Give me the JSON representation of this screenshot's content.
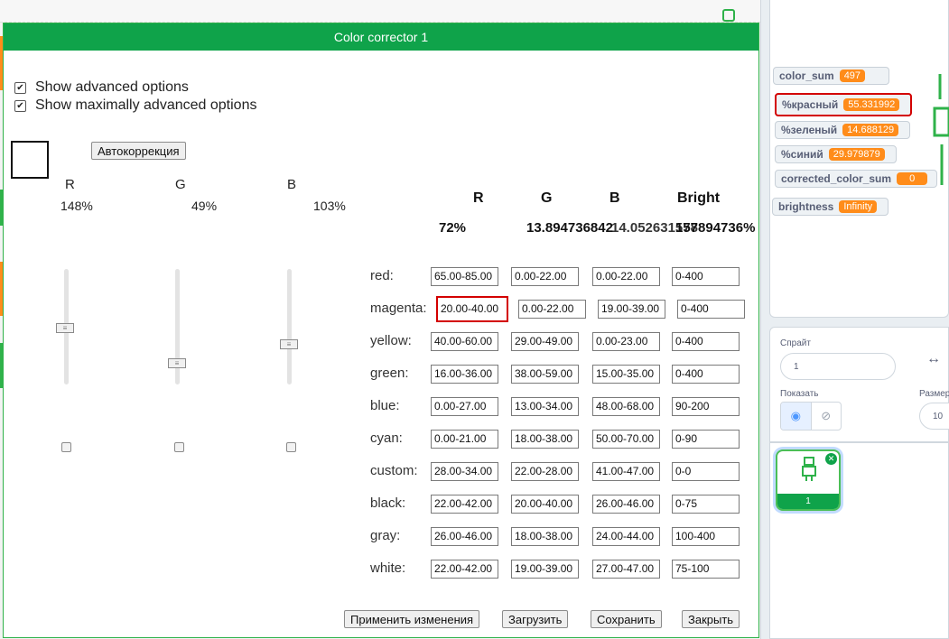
{
  "dialog": {
    "title": "Color corrector 1",
    "options": [
      {
        "label": "Show advanced options",
        "checked": true
      },
      {
        "label": "Show maximally advanced options",
        "checked": true
      }
    ],
    "autocorrect_label": "Автокоррекция",
    "channels": [
      {
        "name": "R",
        "percent": "148%"
      },
      {
        "name": "G",
        "percent": "49%"
      },
      {
        "name": "B",
        "percent": "103%"
      }
    ],
    "table_headers": [
      "R",
      "G",
      "B",
      "Bright"
    ],
    "summary": {
      "r": "72%",
      "gb_overlap": "13.894736842105263157894736%",
      "g_text": "13.894736842",
      "b_text": "14.052631578",
      "bright_text": "157894736%"
    },
    "rows": [
      {
        "name": "red:",
        "r": "65.00-85.00",
        "g": "0.00-22.00",
        "b": "0.00-22.00",
        "bright": "0-400"
      },
      {
        "name": "magenta:",
        "r": "20.00-40.00",
        "g": "0.00-22.00",
        "b": "19.00-39.00",
        "bright": "0-400"
      },
      {
        "name": "yellow:",
        "r": "40.00-60.00",
        "g": "29.00-49.00",
        "b": "0.00-23.00",
        "bright": "0-400"
      },
      {
        "name": "green:",
        "r": "16.00-36.00",
        "g": "38.00-59.00",
        "b": "15.00-35.00",
        "bright": "0-400"
      },
      {
        "name": "blue:",
        "r": "0.00-27.00",
        "g": "13.00-34.00",
        "b": "48.00-68.00",
        "bright": "90-200"
      },
      {
        "name": "cyan:",
        "r": "0.00-21.00",
        "g": "18.00-38.00",
        "b": "50.00-70.00",
        "bright": "0-90"
      },
      {
        "name": "custom:",
        "r": "28.00-34.00",
        "g": "22.00-28.00",
        "b": "41.00-47.00",
        "bright": "0-0"
      },
      {
        "name": "black:",
        "r": "22.00-42.00",
        "g": "20.00-40.00",
        "b": "26.00-46.00",
        "bright": "0-75"
      },
      {
        "name": "gray:",
        "r": "26.00-46.00",
        "g": "18.00-38.00",
        "b": "24.00-44.00",
        "bright": "100-400"
      },
      {
        "name": "white:",
        "r": "22.00-42.00",
        "g": "19.00-39.00",
        "b": "27.00-47.00",
        "bright": "75-100"
      }
    ],
    "buttons": {
      "apply": "Применить изменения",
      "load": "Загрузить",
      "save": "Сохранить",
      "close": "Закрыть"
    }
  },
  "monitors": [
    {
      "label": "color_sum",
      "value": "497"
    },
    {
      "label": "%красный",
      "value": "55.331992"
    },
    {
      "label": "%зеленый",
      "value": "14.688129"
    },
    {
      "label": "%синий",
      "value": "29.979879"
    },
    {
      "label": "corrected_color_sum",
      "value": "0"
    },
    {
      "label": "brightness",
      "value": "Infinity"
    }
  ],
  "sprite_panel": {
    "sprite_label": "Спрайт",
    "sprite_name": "1",
    "show_label": "Показать",
    "size_label": "Размер",
    "size_value": "10",
    "thumb_name": "1"
  },
  "colors": {
    "accent_green": "#0fa34a",
    "highlight_red": "#d30000",
    "monitor_orange": "#ff8c1a"
  }
}
